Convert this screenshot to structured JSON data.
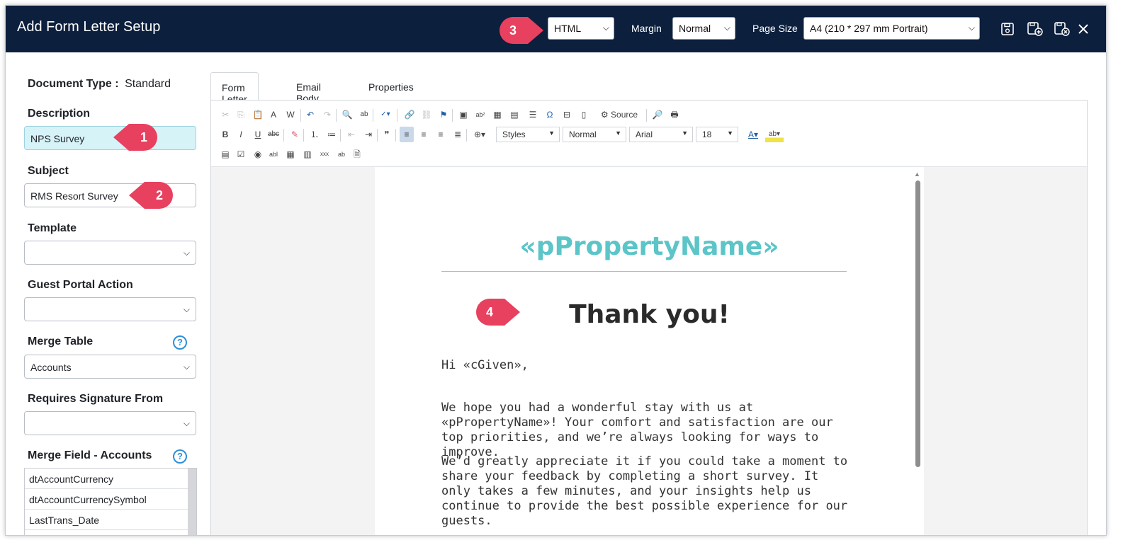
{
  "window": {
    "title": "Add Form Letter Setup"
  },
  "header": {
    "format_value": "HTML",
    "margin_label": "Margin",
    "margin_value": "Normal",
    "page_size_label": "Page Size",
    "page_size_value": "A4 (210 * 297 mm Portrait)",
    "icons": [
      "save-icon",
      "save-as-new-icon",
      "save-and-close-icon",
      "close-icon"
    ]
  },
  "callouts": {
    "c1": "1",
    "c2": "2",
    "c3": "3",
    "c4": "4"
  },
  "colors": {
    "header_bg": "#0c1f3d",
    "callout": "#e8405f",
    "property_name": "#5bc5c8",
    "description_bg": "#d6f3f8"
  },
  "left_panel": {
    "document_type_label": "Document Type :",
    "document_type_value": "Standard",
    "description_label": "Description",
    "description_value": "NPS Survey",
    "subject_label": "Subject",
    "subject_value": "RMS Resort Survey",
    "template_label": "Template",
    "template_value": "",
    "guest_portal_label": "Guest Portal Action",
    "guest_portal_value": "",
    "merge_table_label": "Merge Table",
    "merge_table_value": "Accounts",
    "requires_signature_label": "Requires Signature From",
    "requires_signature_value": "",
    "merge_field_label": "Merge Field - Accounts",
    "merge_fields": [
      "dtAccountCurrency",
      "dtAccountCurrencySymbol",
      "LastTrans_Date"
    ]
  },
  "tabs": [
    "Form Letter",
    "Email Body",
    "Properties"
  ],
  "toolbar": {
    "source_label": "Source",
    "styles_value": "Styles",
    "format_value": "Normal",
    "font_value": "Arial",
    "size_value": "18"
  },
  "document": {
    "property_name": "«pPropertyName»",
    "heading": "Thank you!",
    "greeting": "Hi «cGiven»,",
    "para1": "We hope you had a wonderful stay with us at «pPropertyName»! Your comfort and satisfaction are our top priorities, and we’re always looking for ways to improve.",
    "para2": "We’d greatly appreciate it if you could take a moment to share your feedback by completing a short survey. It only takes a few minutes, and your insights help us continue to provide the best possible experience for our guests."
  }
}
